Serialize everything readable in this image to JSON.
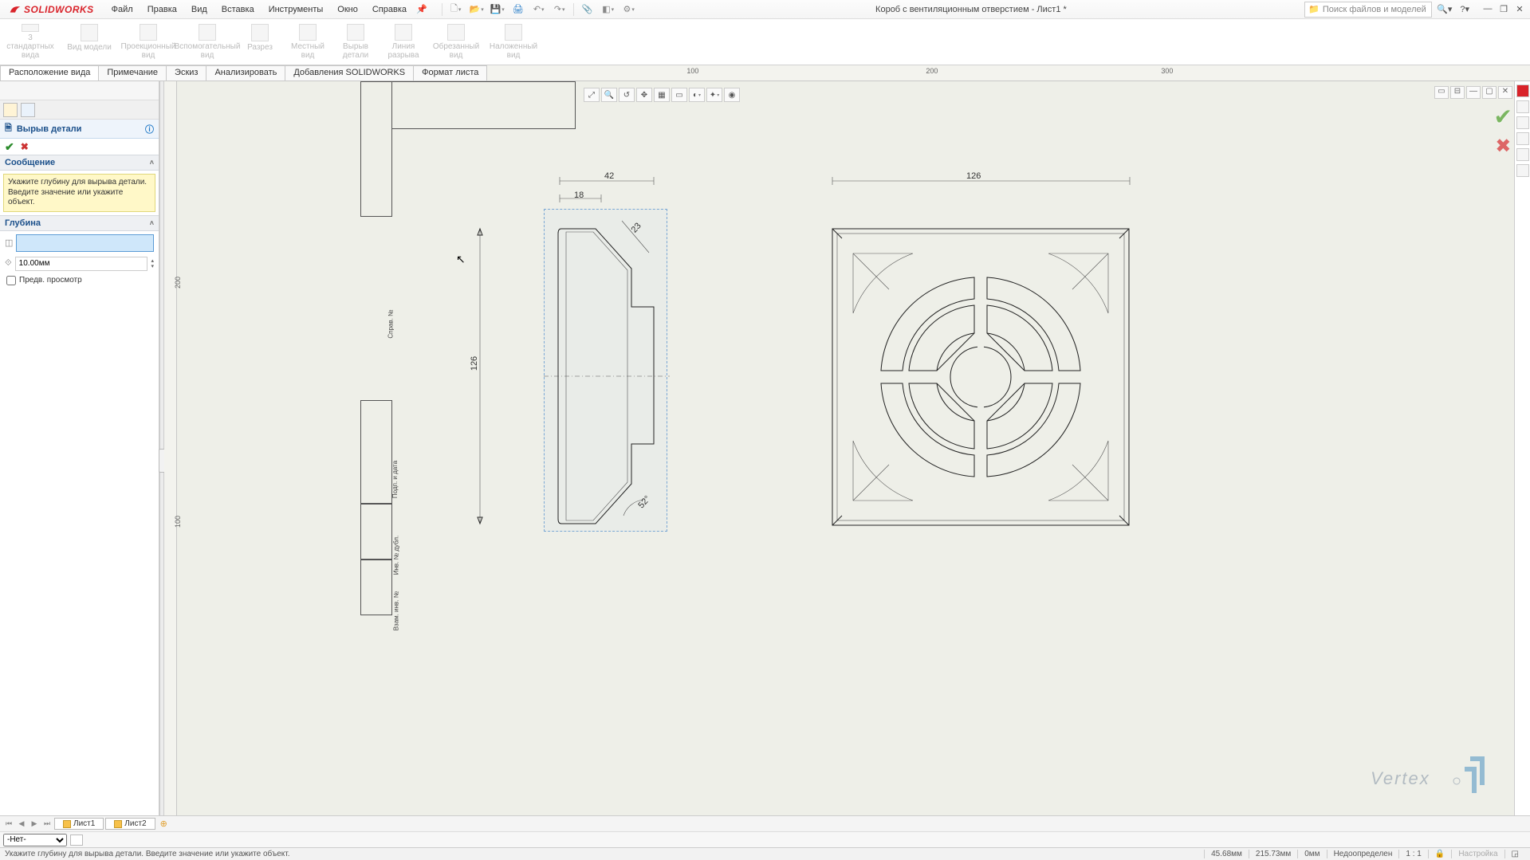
{
  "app": {
    "name": "SOLIDWORKS"
  },
  "menus": {
    "file": "Файл",
    "edit": "Правка",
    "view": "Вид",
    "insert": "Вставка",
    "tools": "Инструменты",
    "window": "Окно",
    "help": "Справка"
  },
  "doc_title": "Короб с вентиляционным отверстием - Лист1 *",
  "search_placeholder": "Поиск файлов и моделей",
  "ribbon": {
    "b1": "3\nстандартных\nвида",
    "b2": "Вид\nмодели",
    "b3": "Проекционный\nвид",
    "b4": "Вспомогательный\nвид",
    "b5": "Разрез",
    "b6": "Местный\nвид",
    "b7": "Вырыв\nдетали",
    "b8": "Линия\nразрыва",
    "b9": "Обрезанный\nвид",
    "b10": "Наложенный\nвид"
  },
  "tabs": {
    "t1": "Расположение вида",
    "t2": "Примечание",
    "t3": "Эскиз",
    "t4": "Анализировать",
    "t5": "Добавления SOLIDWORKS",
    "t6": "Формат листа"
  },
  "ruler": {
    "r100": "100",
    "r200": "200",
    "r300": "300",
    "l200": "200",
    "l100": "100"
  },
  "panel": {
    "title": "Вырыв детали",
    "msg_title": "Сообщение",
    "msg_body": "Укажите глубину для вырыва детали. Введите значение или укажите объект.",
    "depth_title": "Глубина",
    "depth_value": "10.00мм",
    "preview": "Предв. просмотр"
  },
  "dims": {
    "d42": "42",
    "d18": "18",
    "d126a": "126",
    "d126b": "126",
    "d23": "23",
    "d52": "52°"
  },
  "framecol": {
    "c1": "Справ. №",
    "c2": "Подп. и дата",
    "c3": "Инв. № дубл.",
    "c4": "Взам. инв. №"
  },
  "sheets": {
    "s1": "Лист1",
    "s2": "Лист2"
  },
  "layer": {
    "none": "-Нет-"
  },
  "status": {
    "hint": "Укажите глубину для вырыва детали. Введите значение или укажите объект.",
    "x": "45.68мм",
    "y": "215.73мм",
    "z": "0мм",
    "state": "Недоопределен",
    "ratio": "1 : 1",
    "custom": "Настройка"
  },
  "watermark": "Vertex"
}
